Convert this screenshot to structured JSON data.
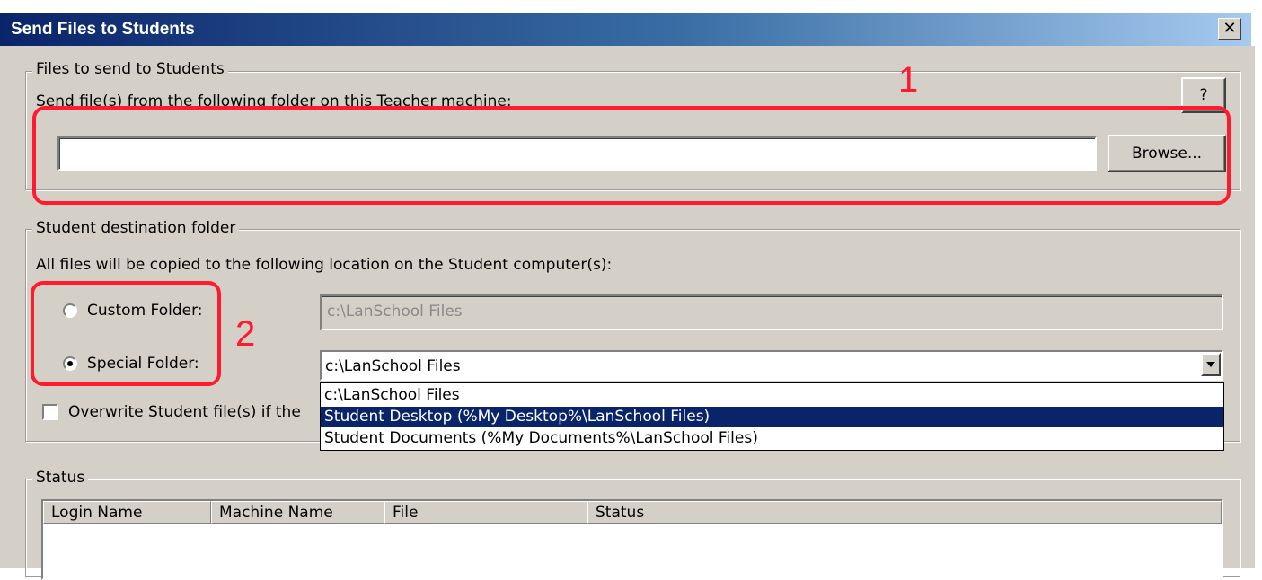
{
  "window": {
    "title": "Send Files to Students",
    "close_label": "✕"
  },
  "files_group": {
    "legend": "Files to send to Students",
    "instruction": "Send file(s) from the following folder on this Teacher machine:",
    "help_label": "?",
    "folder_value": "",
    "browse_label": "Browse..."
  },
  "destination_group": {
    "legend": "Student destination folder",
    "instruction": "All files will be copied to the following location on the Student computer(s):",
    "custom_folder_label": "Custom Folder:",
    "custom_folder_checked": false,
    "custom_folder_value": "c:\\LanSchool Files",
    "special_folder_label": "Special Folder:",
    "special_folder_checked": true,
    "special_folder_value": "c:\\LanSchool Files",
    "overwrite_label": "Overwrite Student file(s) if the",
    "overwrite_checked": false,
    "dropdown_options": [
      "c:\\LanSchool Files",
      "Student Desktop (%My Desktop%\\LanSchool Files)",
      "Student Documents  (%My Documents%\\LanSchool Files)"
    ],
    "dropdown_selected_index": 1
  },
  "status_group": {
    "legend": "Status",
    "columns": [
      "Login Name",
      "Machine Name",
      "File",
      "Status"
    ]
  },
  "annotations": {
    "marker_1": "1",
    "marker_2": "2",
    "color": "#ff1a2d"
  },
  "colors": {
    "dialog_face": "#d4d0c8",
    "titlebar_start": "#0a246a",
    "titlebar_end": "#a6caf0",
    "selection": "#0a246a"
  }
}
